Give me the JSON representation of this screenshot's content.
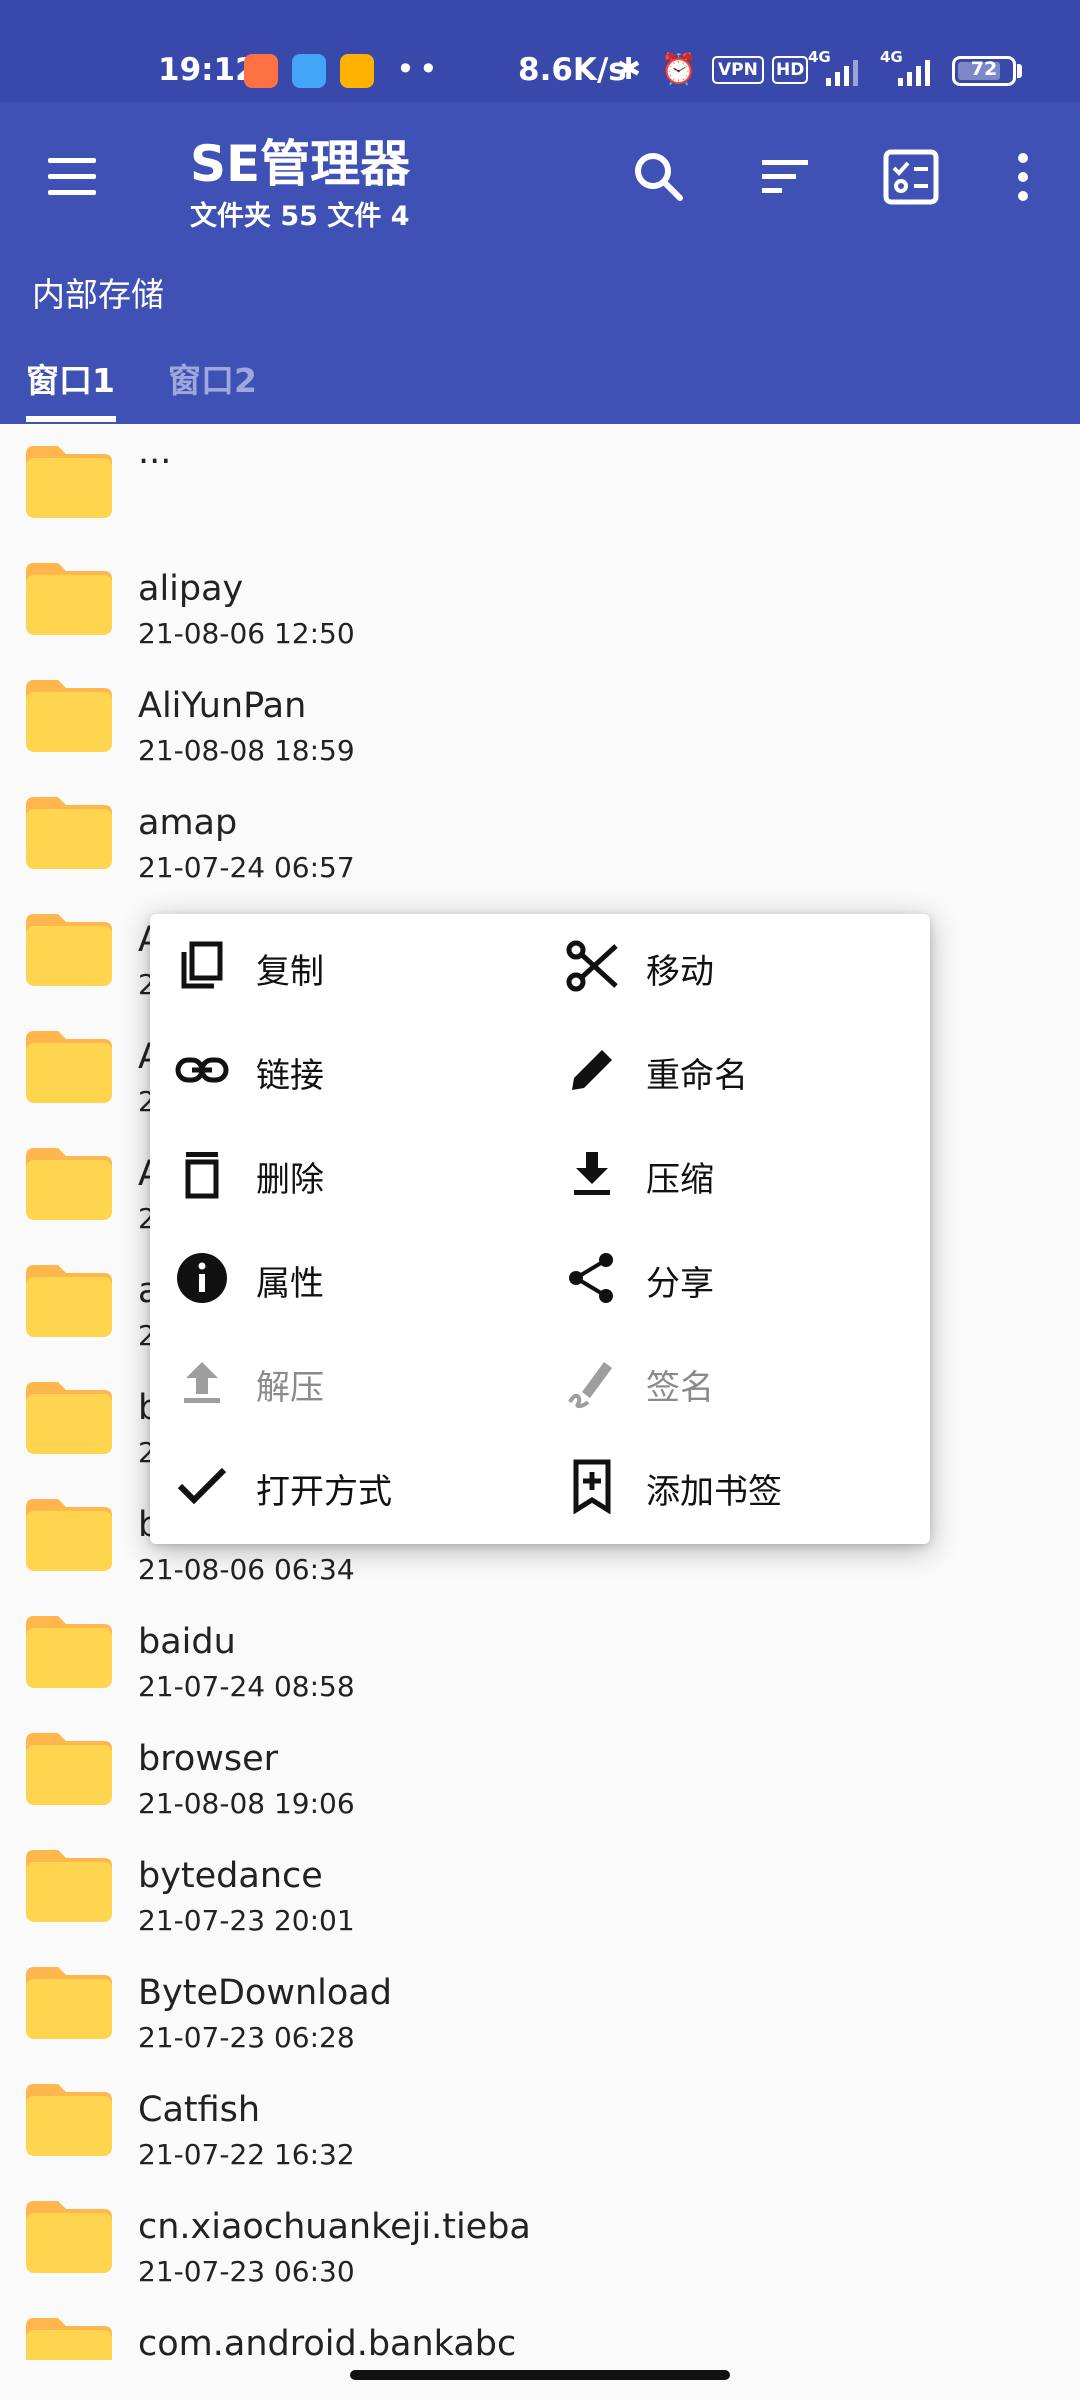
{
  "status_bar": {
    "time": "19:12",
    "dots": "••",
    "net_speed": "8.6K/s",
    "vpn": "VPN",
    "hd": "HD",
    "sim1": "4G",
    "sim2": "4G",
    "battery": "72"
  },
  "app_bar": {
    "title": "SE管理器",
    "subtitle": "文件夹 55  文件 4",
    "path": "内部存储",
    "tabs": [
      {
        "label": "窗口1",
        "active": true
      },
      {
        "label": "窗口2",
        "active": false
      }
    ]
  },
  "files": [
    {
      "name": "...",
      "date": ""
    },
    {
      "name": "alipay",
      "date": "21-08-06 12:50"
    },
    {
      "name": "AliYunPan",
      "date": "21-08-08 18:59"
    },
    {
      "name": "amap",
      "date": "21-07-24 06:57"
    },
    {
      "name": "A",
      "date": "2"
    },
    {
      "name": "A",
      "date": "2"
    },
    {
      "name": "A",
      "date": "2"
    },
    {
      "name": "a",
      "date": "2"
    },
    {
      "name": "b",
      "date": "2"
    },
    {
      "name": "b",
      "date": "21-08-06 06:34"
    },
    {
      "name": "baidu",
      "date": "21-07-24 08:58"
    },
    {
      "name": "browser",
      "date": "21-08-08 19:06"
    },
    {
      "name": "bytedance",
      "date": "21-07-23 20:01"
    },
    {
      "name": "ByteDownload",
      "date": "21-07-23 06:28"
    },
    {
      "name": "Catfish",
      "date": "21-07-22 16:32"
    },
    {
      "name": "cn.xiaochuankeji.tieba",
      "date": "21-07-23 06:30"
    },
    {
      "name": "com.android.bankabc",
      "date": ""
    }
  ],
  "context_menu": {
    "items": [
      {
        "label": "复制",
        "icon": "copy-icon",
        "enabled": true
      },
      {
        "label": "移动",
        "icon": "scissors-icon",
        "enabled": true
      },
      {
        "label": "链接",
        "icon": "link-icon",
        "enabled": true
      },
      {
        "label": "重命名",
        "icon": "pencil-icon",
        "enabled": true
      },
      {
        "label": "删除",
        "icon": "trash-icon",
        "enabled": true
      },
      {
        "label": "压缩",
        "icon": "download-icon",
        "enabled": true
      },
      {
        "label": "属性",
        "icon": "info-icon",
        "enabled": true
      },
      {
        "label": "分享",
        "icon": "share-icon",
        "enabled": true
      },
      {
        "label": "解压",
        "icon": "upload-icon",
        "enabled": false
      },
      {
        "label": "签名",
        "icon": "signature-icon",
        "enabled": false
      },
      {
        "label": "打开方式",
        "icon": "check-icon",
        "enabled": true
      },
      {
        "label": "添加书签",
        "icon": "bookmark-add-icon",
        "enabled": true
      }
    ]
  },
  "colors": {
    "status_bar": "#3949ab",
    "app_bar": "#3f51b5",
    "folder_body": "#ffd54f",
    "folder_tab": "#ffb74d"
  }
}
